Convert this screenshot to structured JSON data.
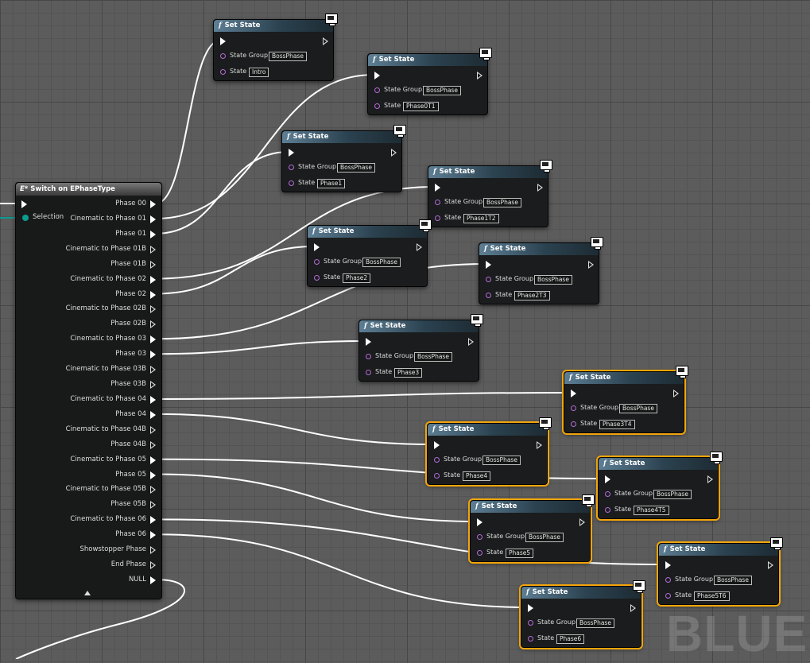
{
  "switch_node": {
    "title": "Switch on EPhaseType",
    "icon": "E*",
    "selection_label": "Selection",
    "outputs": [
      "Phase 00",
      "Cinematic to Phase 01",
      "Phase 01",
      "Cinematic to Phase 01B",
      "Phase 01B",
      "Cinematic to Phase 02",
      "Phase 02",
      "Cinematic to Phase 02B",
      "Phase 02B",
      "Cinematic to Phase 03",
      "Phase 03",
      "Cinematic to Phase 03B",
      "Phase 03B",
      "Cinematic to Phase 04",
      "Phase 04",
      "Cinematic to Phase 04B",
      "Phase 04B",
      "Cinematic to Phase 05",
      "Phase 05",
      "Cinematic to Phase 05B",
      "Phase 05B",
      "Cinematic to Phase 06",
      "Phase 06",
      "Showstopper Phase",
      "End Phase",
      "NULL"
    ],
    "connected": [
      true,
      true,
      true,
      false,
      false,
      true,
      true,
      false,
      false,
      true,
      true,
      false,
      false,
      true,
      true,
      false,
      false,
      true,
      true,
      false,
      false,
      true,
      true,
      false,
      false,
      true
    ]
  },
  "set_state_nodes": [
    {
      "title": "Set State",
      "fx": "f",
      "group_label": "State Group",
      "group_value": "BossPhase",
      "state_label": "State",
      "state_value": "Intro",
      "selected": false
    },
    {
      "title": "Set State",
      "fx": "f",
      "group_label": "State Group",
      "group_value": "BossPhase",
      "state_label": "State",
      "state_value": "Phase0T1",
      "selected": false
    },
    {
      "title": "Set State",
      "fx": "f",
      "group_label": "State Group",
      "group_value": "BossPhase",
      "state_label": "State",
      "state_value": "Phase1",
      "selected": false
    },
    {
      "title": "Set State",
      "fx": "f",
      "group_label": "State Group",
      "group_value": "BossPhase",
      "state_label": "State",
      "state_value": "Phase1T2",
      "selected": false
    },
    {
      "title": "Set State",
      "fx": "f",
      "group_label": "State Group",
      "group_value": "BossPhase",
      "state_label": "State",
      "state_value": "Phase2",
      "selected": false
    },
    {
      "title": "Set State",
      "fx": "f",
      "group_label": "State Group",
      "group_value": "BossPhase",
      "state_label": "State",
      "state_value": "Phase2T3",
      "selected": false
    },
    {
      "title": "Set State",
      "fx": "f",
      "group_label": "State Group",
      "group_value": "BossPhase",
      "state_label": "State",
      "state_value": "Phase3",
      "selected": false
    },
    {
      "title": "Set State",
      "fx": "f",
      "group_label": "State Group",
      "group_value": "BossPhase",
      "state_label": "State",
      "state_value": "Phase3T4",
      "selected": true
    },
    {
      "title": "Set State",
      "fx": "f",
      "group_label": "State Group",
      "group_value": "BossPhase",
      "state_label": "State",
      "state_value": "Phase4",
      "selected": true
    },
    {
      "title": "Set State",
      "fx": "f",
      "group_label": "State Group",
      "group_value": "BossPhase",
      "state_label": "State",
      "state_value": "Phase4T5",
      "selected": true
    },
    {
      "title": "Set State",
      "fx": "f",
      "group_label": "State Group",
      "group_value": "BossPhase",
      "state_label": "State",
      "state_value": "Phase5",
      "selected": true
    },
    {
      "title": "Set State",
      "fx": "f",
      "group_label": "State Group",
      "group_value": "BossPhase",
      "state_label": "State",
      "state_value": "Phase5T6",
      "selected": true
    },
    {
      "title": "Set State",
      "fx": "f",
      "group_label": "State Group",
      "group_value": "BossPhase",
      "state_label": "State",
      "state_value": "Phase6",
      "selected": true
    }
  ],
  "watermark": "BLUEPI",
  "colors": {
    "exec_wire": "#ffffff",
    "selection_wire": "#0c9b91",
    "selected_outline": "#f2a50a",
    "object_pin": "#b56bd9"
  }
}
